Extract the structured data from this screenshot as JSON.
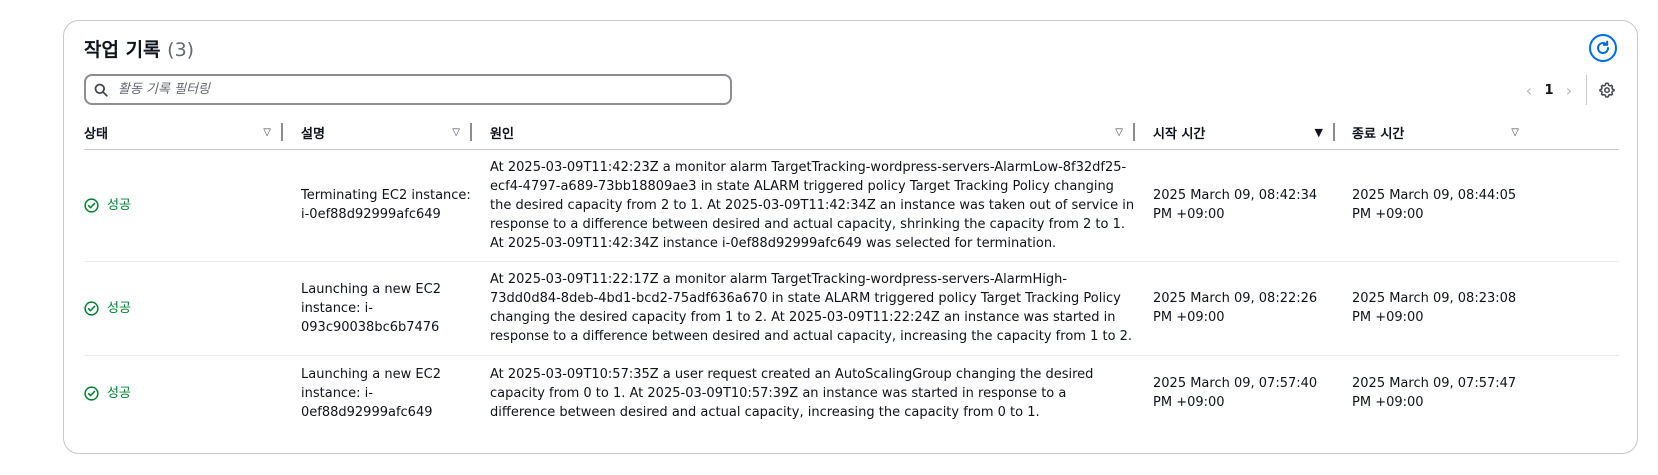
{
  "panel": {
    "title": "작업 기록",
    "count": "(3)",
    "search_placeholder": "활동 기록 필터링",
    "pagination": {
      "prev": "‹",
      "page": "1",
      "next": "›"
    }
  },
  "columns": [
    {
      "label": "상태",
      "sort": "▽"
    },
    {
      "label": "설명",
      "sort": "▽"
    },
    {
      "label": "원인",
      "sort": "▽"
    },
    {
      "label": "시작 시간",
      "sort": "▼"
    },
    {
      "label": "종료 시간",
      "sort": "▽"
    }
  ],
  "rows": [
    {
      "status": "성공",
      "description": "Terminating EC2 instance: i-0ef88d92999afc649",
      "cause": "At 2025-03-09T11:42:23Z a monitor alarm TargetTracking-wordpress-servers-AlarmLow-8f32df25-ecf4-4797-a689-73bb18809ae3 in state ALARM triggered policy Target Tracking Policy changing the desired capacity from 2 to 1. At 2025-03-09T11:42:34Z an instance was taken out of service in response to a difference between desired and actual capacity, shrinking the capacity from 2 to 1. At 2025-03-09T11:42:34Z instance i-0ef88d92999afc649 was selected for termination.",
      "start": "2025 March 09, 08:42:34 PM +09:00",
      "end": "2025 March 09, 08:44:05 PM +09:00"
    },
    {
      "status": "성공",
      "description": "Launching a new EC2 instance: i-093c90038bc6b7476",
      "cause": "At 2025-03-09T11:22:17Z a monitor alarm TargetTracking-wordpress-servers-AlarmHigh-73dd0d84-8deb-4bd1-bcd2-75adf636a670 in state ALARM triggered policy Target Tracking Policy changing the desired capacity from 1 to 2. At 2025-03-09T11:22:24Z an instance was started in response to a difference between desired and actual capacity, increasing the capacity from 1 to 2.",
      "start": "2025 March 09, 08:22:26 PM +09:00",
      "end": "2025 March 09, 08:23:08 PM +09:00"
    },
    {
      "status": "성공",
      "description": "Launching a new EC2 instance: i-0ef88d92999afc649",
      "cause": "At 2025-03-09T10:57:35Z a user request created an AutoScalingGroup changing the desired capacity from 0 to 1. At 2025-03-09T10:57:39Z an instance was started in response to a difference between desired and actual capacity, increasing the capacity from 0 to 1.",
      "start": "2025 March 09, 07:57:40 PM +09:00",
      "end": "2025 March 09, 07:57:47 PM +09:00"
    }
  ]
}
